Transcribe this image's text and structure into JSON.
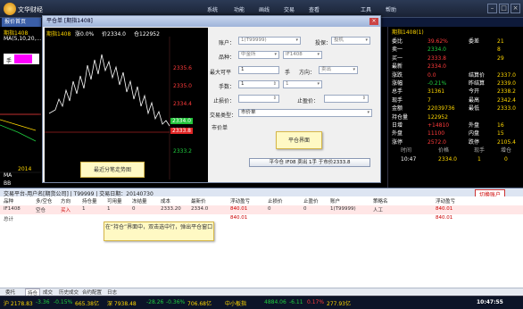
{
  "app": {
    "brand": "文华财经",
    "menus": [
      "系统",
      "功能",
      "画线",
      "交易",
      "查看",
      "工具",
      "帮助"
    ],
    "active_tab": "报价首页"
  },
  "chart": {
    "contract": "期指1408",
    "change_pct": "涨0.0%",
    "price": "价2334.0",
    "open_interest": "仓122952",
    "indicator": "MA(5,10,20,…",
    "hand_label": "手",
    "y_ticks": [
      "2335.6",
      "2335.0",
      "2334.4",
      "2334.0",
      "2333.8",
      "2333.2"
    ],
    "price_tag_green": "2334.0",
    "price_tag_red": "2333.8",
    "bottom_labels": [
      "MA",
      "BB"
    ],
    "year": "2014"
  },
  "dialog": {
    "title": "平仓单 [期指1408]",
    "account_label": "账户：",
    "account_value": "1(T99999)",
    "hedge_label": "投保：",
    "hedge_value": "投机",
    "variety_label": "品种：",
    "variety_value": "中金所",
    "contract_value": "IF1408",
    "max_close_label": "最大可平",
    "max_close_value": "1",
    "hand_label": "手",
    "direction_label": "方向：",
    "direction_value": "卖出",
    "qty_label": "手数：",
    "qty_value": "1",
    "stop_loss_label": "止损价：",
    "stop_profit_label": "止盈价：",
    "order_type_label": "交易类型：",
    "order_type_value": "市价单",
    "market_label": "市价单",
    "submit_label": "平今仓 IF08 卖出 1手 于市价2333.8",
    "note_close": "平仓界面",
    "note_quick": "最近分笔走势图"
  },
  "quote": {
    "title": "期指1408(1)",
    "rows": [
      {
        "label": "委比",
        "value": "39.62%",
        "extra": "委差",
        "extra2": "21"
      },
      {
        "label": "卖一",
        "value": "2334.0",
        "extra": "",
        "extra2": "8"
      },
      {
        "label": "买一",
        "value": "2333.8",
        "extra": "",
        "extra2": "29"
      },
      {
        "label": "最新",
        "value": "2334.0",
        "extra": "",
        "extra2": ""
      },
      {
        "label": "涨跌",
        "value": "0.0",
        "extra": "结算价",
        "extra2": "2337.0"
      },
      {
        "label": "涨幅",
        "value": "-0.21%",
        "extra": "昨结算",
        "extra2": "2339.0"
      },
      {
        "label": "总手",
        "value": "31361",
        "extra": "今开",
        "extra2": "2338.2"
      },
      {
        "label": "现手",
        "value": "7",
        "extra": "最高",
        "extra2": "2342.4"
      },
      {
        "label": "金额",
        "value": "22039736",
        "extra": "最低",
        "extra2": "2333.0"
      },
      {
        "label": "持仓量",
        "value": "122952",
        "extra": "",
        "extra2": ""
      },
      {
        "label": "日增",
        "value": "+14810",
        "extra": "外盘",
        "extra2": "16"
      },
      {
        "label": "外盘",
        "value": "11100",
        "extra": "内盘",
        "extra2": "15"
      },
      {
        "label": "涨停",
        "value": "2572.0",
        "extra": "跌停",
        "extra2": "2105.4"
      }
    ],
    "ticks_header": [
      "时间",
      "价格",
      "现手",
      "增仓"
    ],
    "tick": {
      "time": "10:47",
      "price": "2334.0",
      "vol": "1",
      "oi": "0"
    }
  },
  "trade": {
    "bar_title": "交易平台-用户名[期货公司] | T99999 | 交易日期：20140730",
    "switch_btn": "切换账户",
    "columns": [
      "品种",
      "多/空仓",
      "方向",
      "持仓量",
      "可用量",
      "冻结量",
      "成本",
      "最新价",
      "浮动盈亏",
      "止损价",
      "止盈价",
      "账户",
      "策略名",
      "浮动盈亏"
    ],
    "rows": [
      {
        "c": [
          "IF1408",
          "空仓",
          "买入",
          "1",
          "1",
          "0",
          "2333.20",
          "2334.0",
          "840.01",
          "0",
          "0",
          "1(T99999)",
          "人工",
          "840.01"
        ]
      },
      {
        "c": [
          "总计",
          "",
          "",
          "",
          "",
          "",
          "",
          "",
          "840.01",
          "",
          "",
          "",
          "",
          "840.01"
        ]
      }
    ],
    "note": "在“持仓”界面中，双击选中行，弹出平仓窗口",
    "bottom_tabs": [
      "委托",
      "持仓",
      "成交",
      "历史成交",
      "合约配置",
      "日志"
    ]
  },
  "status": {
    "items": [
      "沪 2178.83",
      "-3.36",
      "-0.15%",
      "665.38亿",
      "深 7938.48",
      "-28.26",
      "-0.36%",
      "706.68亿",
      "中小板指",
      "4884.06",
      "-6.11",
      "0.17%",
      "277.93亿"
    ],
    "time": "10:47:55"
  }
}
